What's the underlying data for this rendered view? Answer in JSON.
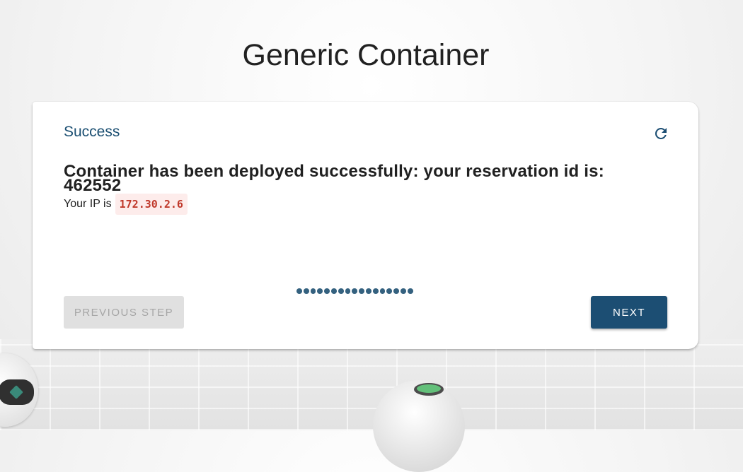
{
  "page": {
    "title": "Generic Container"
  },
  "card": {
    "status_title": "Success",
    "refresh_icon": "refresh-icon",
    "message_line1": "Container has been deployed successfully: your reservation id is:",
    "message_line2": "462552",
    "ip_prefix": "Your IP is",
    "ip_value": "172.30.2.6"
  },
  "stepper": {
    "total_steps": 17,
    "current_step": 17
  },
  "buttons": {
    "previous_label": "PREVIOUS STEP",
    "next_label": "NEXT"
  },
  "colors": {
    "accent": "#1c4e73",
    "title_blue": "#1b4f72",
    "ip_text": "#c0392b",
    "ip_bg": "#fdeceb",
    "disabled_bg": "#e0e0e0"
  }
}
